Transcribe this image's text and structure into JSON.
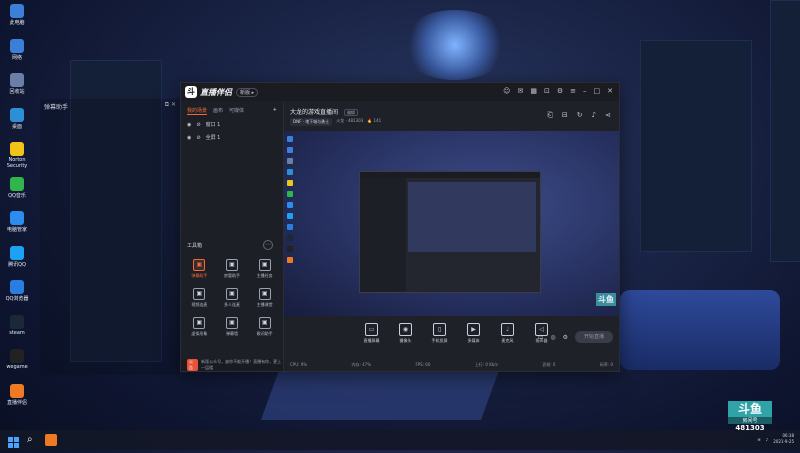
{
  "desktop": {
    "icons": [
      {
        "label": "此电脑",
        "icon": "computer-icon",
        "color": "#3b7fd9"
      },
      {
        "label": "网络",
        "icon": "network-icon",
        "color": "#3b7fd9"
      },
      {
        "label": "回收站",
        "icon": "recycle-bin-icon",
        "color": "#6a7fa8"
      },
      {
        "label": "桌面",
        "icon": "vscode-icon",
        "color": "#2d8fd6"
      },
      {
        "label": "Norton Security",
        "icon": "norton-icon",
        "color": "#f0c419"
      },
      {
        "label": "QQ音乐",
        "icon": "qqmusic-icon",
        "color": "#2fb54a"
      },
      {
        "label": "电脑管家",
        "icon": "pcmanager-icon",
        "color": "#2c8cf0"
      },
      {
        "label": "腾讯QQ",
        "icon": "qq-icon",
        "color": "#1da1f2"
      },
      {
        "label": "QQ浏览器",
        "icon": "qqbrowser-icon",
        "color": "#2a7de1"
      },
      {
        "label": "steam",
        "icon": "steam-icon",
        "color": "#1b2838"
      },
      {
        "label": "wegame",
        "icon": "wegame-icon",
        "color": "#222"
      },
      {
        "label": "直播伴侣",
        "icon": "douyu-companion-icon",
        "color": "#f07a23"
      }
    ]
  },
  "dock": {
    "title": "弹幕助手",
    "controls": "⧉ ✕"
  },
  "app": {
    "logo_mark": "斗",
    "logo_text": "直播伴侣",
    "version": "新版 ▸",
    "left_tabs": [
      "我的场景",
      "画布",
      "可媒体"
    ],
    "add_label": "+",
    "sources": [
      {
        "name": "窗口 1",
        "eye": "◉",
        "lock": "🔒"
      },
      {
        "name": "全屏 1",
        "eye": "◉",
        "lock": "🔒"
      }
    ],
    "toolbox_title": "工具箱",
    "toolbox_more": "⋯",
    "tools": [
      {
        "label": "弹幕助手",
        "icon": "danmaku-icon",
        "active": true
      },
      {
        "label": "房管助手",
        "icon": "room-manager-icon"
      },
      {
        "label": "主播任务",
        "icon": "task-icon"
      },
      {
        "label": "视频连麦",
        "icon": "video-link-icon"
      },
      {
        "label": "多人连麦",
        "icon": "multi-link-icon"
      },
      {
        "label": "主播课堂",
        "icon": "class-icon"
      },
      {
        "label": "虚拟形象",
        "icon": "avatar-icon"
      },
      {
        "label": "弹幕墙",
        "icon": "danmaku-wall-icon"
      },
      {
        "label": "歌词助手",
        "icon": "lyrics-icon"
      }
    ],
    "notice_tag": "公告",
    "notice": "新版公众号，缺你不能开播！直播有你，更上一层楼",
    "room_title": "大龙的游戏直播间",
    "room_edit": "编辑",
    "room_category": "DNF · 地下城与勇士",
    "room_meta": "火龙 · 481303",
    "room_followers": "🔥 141",
    "bottom_controls": [
      {
        "label": "直播屏幕",
        "icon": "screen-icon"
      },
      {
        "label": "摄像头",
        "icon": "camera-icon"
      },
      {
        "label": "手机投屏",
        "icon": "phone-icon"
      },
      {
        "label": "多媒体",
        "icon": "media-icon"
      },
      {
        "label": "麦克风",
        "icon": "mic-icon"
      },
      {
        "label": "扬声器",
        "icon": "speaker-icon"
      }
    ],
    "go_live": "开始直播",
    "stats": [
      "CPU: 9%",
      "内存: 47%",
      "FPS: 60",
      "上行: 0 Kb/s",
      "丢帧: 0",
      "码率: 0"
    ]
  },
  "watermark": {
    "brand": "斗鱼",
    "label": "房间号",
    "room": "481303"
  },
  "taskbar": {
    "time": "06:38",
    "date": "2021-9-25"
  }
}
